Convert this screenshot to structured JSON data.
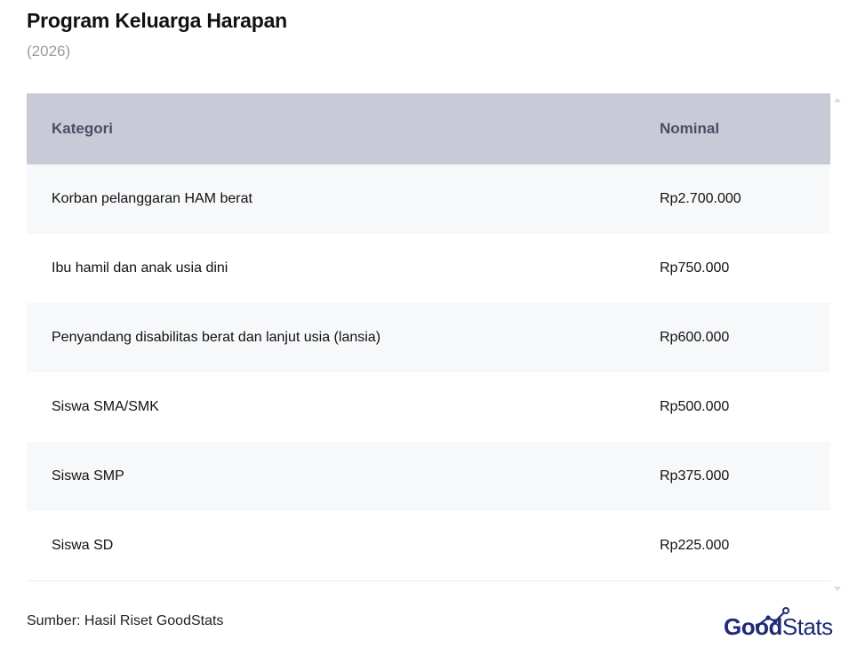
{
  "title": "Program Keluarga Harapan",
  "subtitle": "(2026)",
  "chart_data": {
    "type": "table",
    "columns": [
      "Kategori",
      "Nominal"
    ],
    "rows": [
      [
        "Korban pelanggaran HAM berat",
        "Rp2.700.000"
      ],
      [
        "Ibu hamil dan anak usia dini",
        "Rp750.000"
      ],
      [
        "Penyandang disabilitas berat dan lanjut usia (lansia)",
        "Rp600.000"
      ],
      [
        "Siswa SMA/SMK",
        "Rp500.000"
      ],
      [
        "Siswa SMP",
        "Rp375.000"
      ],
      [
        "Siswa SD",
        "Rp225.000"
      ]
    ],
    "values": [
      2700000,
      750000,
      600000,
      500000,
      375000,
      225000
    ]
  },
  "source": "Sumber: Hasil Riset GoodStats",
  "logo": {
    "part1": "Good",
    "part2": "Stats",
    "color": "#1e2a78"
  },
  "colors": {
    "header_bg": "#c8cad8",
    "header_text": "#4a4d63",
    "row_alt": "#f7f8fa"
  }
}
